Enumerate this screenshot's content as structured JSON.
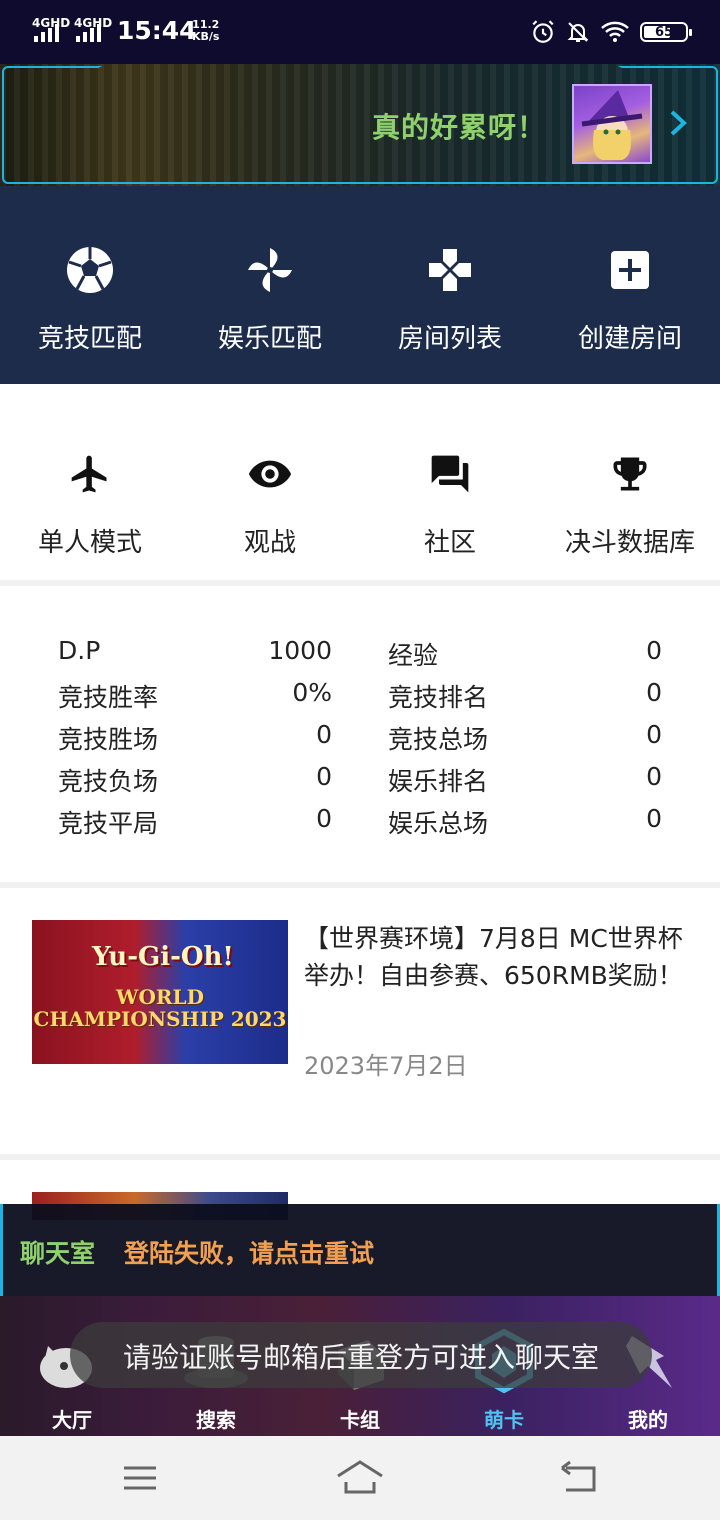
{
  "status_bar": {
    "net1": "4GHD",
    "net2": "4GHD",
    "time": "15:44",
    "speed_value": "11.2",
    "speed_unit": "KB/s",
    "battery": "65",
    "icons": [
      "alarm-icon",
      "mute-bell-icon",
      "wifi-icon",
      "battery-icon"
    ]
  },
  "banner": {
    "text": "真的好累呀！",
    "text_color": "#8fd16c",
    "frame_color": "#1db5df"
  },
  "main_menu": [
    {
      "label": "竞技匹配",
      "icon": "soccer-ball-icon"
    },
    {
      "label": "娱乐匹配",
      "icon": "pinwheel-icon"
    },
    {
      "label": "房间列表",
      "icon": "gamepad-cross-icon"
    },
    {
      "label": "创建房间",
      "icon": "add-box-icon"
    }
  ],
  "secondary_menu": [
    {
      "label": "单人模式",
      "icon": "airplane-icon"
    },
    {
      "label": "观战",
      "icon": "eye-icon"
    },
    {
      "label": "社区",
      "icon": "chat-bubbles-icon"
    },
    {
      "label": "决斗数据库",
      "icon": "trophy-icon"
    }
  ],
  "stats": {
    "left": [
      {
        "label": "D.P",
        "value": "1000"
      },
      {
        "label": "竞技胜率",
        "value": "0%"
      },
      {
        "label": "竞技胜场",
        "value": "0"
      },
      {
        "label": "竞技负场",
        "value": "0"
      },
      {
        "label": "竞技平局",
        "value": "0"
      }
    ],
    "right": [
      {
        "label": "经验",
        "value": "0"
      },
      {
        "label": "竞技排名",
        "value": "0"
      },
      {
        "label": "竞技总场",
        "value": "0"
      },
      {
        "label": "娱乐排名",
        "value": "0"
      },
      {
        "label": "娱乐总场",
        "value": "0"
      }
    ]
  },
  "news": [
    {
      "title": "【世界赛环境】7月8日 MC世界杯举办！自由参赛、650RMB奖励！",
      "date": "2023年7月2日",
      "image_text_1": "Yu-Gi-Oh!",
      "image_text_2": "WORLD CHAMPIONSHIP 2023"
    }
  ],
  "chat": {
    "label": "聊天室",
    "message": "登陆失败，请点击重试",
    "label_color": "#8fd16c",
    "message_color": "#f0a050"
  },
  "tabs": [
    {
      "label": "大厅",
      "icon": "dolphin-icon",
      "active": false
    },
    {
      "label": "搜索",
      "icon": "top-hat-icon",
      "active": false
    },
    {
      "label": "卡组",
      "icon": "card-deck-icon",
      "active": false
    },
    {
      "label": "萌卡",
      "icon": "mycard-logo-icon",
      "active": true
    },
    {
      "label": "我的",
      "icon": "profile-emblem-icon",
      "active": false
    }
  ],
  "toast": "请验证账号邮箱后重登方可进入聊天室",
  "accent_color": "#4fc3ef"
}
